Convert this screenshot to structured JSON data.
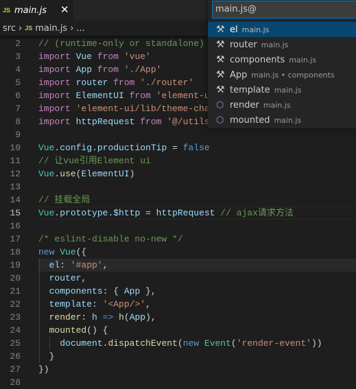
{
  "tab": {
    "icon": "js-file-icon",
    "label": "main.js",
    "close": "✕"
  },
  "breadcrumb": {
    "folder": "src",
    "sep": "›",
    "file": "main.js",
    "more": "..."
  },
  "quick_pick": {
    "input_value": "main.js@",
    "items": [
      {
        "icon": "wrench-icon",
        "label": "el",
        "desc": "main.js",
        "selected": true
      },
      {
        "icon": "wrench-icon",
        "label": "router",
        "desc": "main.js"
      },
      {
        "icon": "wrench-icon",
        "label": "components",
        "desc": "main.js"
      },
      {
        "icon": "wrench-icon",
        "label": "App",
        "desc": "main.js • components"
      },
      {
        "icon": "wrench-icon",
        "label": "template",
        "desc": "main.js"
      },
      {
        "icon": "cube-icon",
        "label": "render",
        "desc": "main.js"
      },
      {
        "icon": "cube-icon",
        "label": "mounted",
        "desc": "main.js"
      }
    ]
  },
  "editor": {
    "current_line": 15,
    "lines": [
      {
        "n": "2",
        "t": [
          [
            "c",
            "// (runtime-only or standalone)"
          ]
        ]
      },
      {
        "n": "3",
        "t": [
          [
            "k",
            "import "
          ],
          [
            "v",
            "Vue "
          ],
          [
            "k",
            "from "
          ],
          [
            "s",
            "'vue'"
          ]
        ]
      },
      {
        "n": "4",
        "t": [
          [
            "k",
            "import "
          ],
          [
            "v",
            "App "
          ],
          [
            "k",
            "from "
          ],
          [
            "s",
            "'./App'"
          ]
        ]
      },
      {
        "n": "5",
        "t": [
          [
            "k",
            "import "
          ],
          [
            "v",
            "router "
          ],
          [
            "k",
            "from "
          ],
          [
            "s",
            "'./router'"
          ]
        ]
      },
      {
        "n": "6",
        "t": [
          [
            "k",
            "import "
          ],
          [
            "v",
            "ElementUI "
          ],
          [
            "k",
            "from "
          ],
          [
            "s",
            "'element-ui'"
          ]
        ]
      },
      {
        "n": "7",
        "t": [
          [
            "k",
            "import "
          ],
          [
            "s",
            "'element-ui/lib/theme-chalk/index.css'"
          ]
        ]
      },
      {
        "n": "8",
        "t": [
          [
            "k",
            "import "
          ],
          [
            "v",
            "httpRequest "
          ],
          [
            "k",
            "from "
          ],
          [
            "s",
            "'@/utils/httpRequest'"
          ]
        ]
      },
      {
        "n": "9",
        "t": []
      },
      {
        "n": "10",
        "t": [
          [
            "t",
            "Vue"
          ],
          [
            "p",
            "."
          ],
          [
            "v",
            "config"
          ],
          [
            "p",
            "."
          ],
          [
            "v",
            "productionTip"
          ],
          [
            "p",
            " = "
          ],
          [
            "b",
            "false"
          ]
        ]
      },
      {
        "n": "11",
        "t": [
          [
            "c",
            "// 让vue引用Element ui"
          ]
        ]
      },
      {
        "n": "12",
        "t": [
          [
            "t",
            "Vue"
          ],
          [
            "p",
            "."
          ],
          [
            "f",
            "use"
          ],
          [
            "p",
            "("
          ],
          [
            "v",
            "ElementUI"
          ],
          [
            "p",
            ")"
          ]
        ]
      },
      {
        "n": "13",
        "t": []
      },
      {
        "n": "14",
        "t": [
          [
            "c",
            "// 挂载全局"
          ]
        ]
      },
      {
        "n": "15",
        "t": [
          [
            "t",
            "Vue"
          ],
          [
            "p",
            "."
          ],
          [
            "v",
            "prototype"
          ],
          [
            "p",
            "."
          ],
          [
            "v",
            "$http"
          ],
          [
            "p",
            " = "
          ],
          [
            "v",
            "httpRequest "
          ],
          [
            "c",
            "// ajax请求方法"
          ]
        ]
      },
      {
        "n": "16",
        "t": []
      },
      {
        "n": "17",
        "t": [
          [
            "c",
            "/* eslint-disable no-new */"
          ]
        ]
      },
      {
        "n": "18",
        "t": [
          [
            "b",
            "new "
          ],
          [
            "t",
            "Vue"
          ],
          [
            "p",
            "({"
          ]
        ]
      },
      {
        "n": "19",
        "t": [
          [
            "p",
            "  "
          ],
          [
            "v",
            "el"
          ],
          [
            "p",
            ": "
          ],
          [
            "s",
            "'#app'"
          ],
          [
            "p",
            ","
          ]
        ]
      },
      {
        "n": "20",
        "t": [
          [
            "p",
            "  "
          ],
          [
            "v",
            "router"
          ],
          [
            "p",
            ","
          ]
        ]
      },
      {
        "n": "21",
        "t": [
          [
            "p",
            "  "
          ],
          [
            "v",
            "components"
          ],
          [
            "p",
            ": { "
          ],
          [
            "v",
            "App"
          ],
          [
            "p",
            " },"
          ]
        ]
      },
      {
        "n": "22",
        "t": [
          [
            "p",
            "  "
          ],
          [
            "v",
            "template"
          ],
          [
            "p",
            ": "
          ],
          [
            "s",
            "'<App/>'"
          ],
          [
            "p",
            ","
          ]
        ]
      },
      {
        "n": "23",
        "t": [
          [
            "p",
            "  "
          ],
          [
            "f",
            "render"
          ],
          [
            "p",
            ": "
          ],
          [
            "v",
            "h"
          ],
          [
            "b",
            " => "
          ],
          [
            "f",
            "h"
          ],
          [
            "p",
            "("
          ],
          [
            "v",
            "App"
          ],
          [
            "p",
            "),"
          ]
        ]
      },
      {
        "n": "24",
        "t": [
          [
            "p",
            "  "
          ],
          [
            "f",
            "mounted"
          ],
          [
            "p",
            "() {"
          ]
        ]
      },
      {
        "n": "25",
        "t": [
          [
            "p",
            "    "
          ],
          [
            "v",
            "document"
          ],
          [
            "p",
            "."
          ],
          [
            "f",
            "dispatchEvent"
          ],
          [
            "p",
            "("
          ],
          [
            "b",
            "new "
          ],
          [
            "t",
            "Event"
          ],
          [
            "p",
            "("
          ],
          [
            "s",
            "'render-event'"
          ],
          [
            "p",
            "))"
          ]
        ]
      },
      {
        "n": "26",
        "t": [
          [
            "p",
            "  }"
          ]
        ]
      },
      {
        "n": "27",
        "t": [
          [
            "p",
            "})"
          ]
        ]
      },
      {
        "n": "28",
        "t": []
      }
    ]
  }
}
